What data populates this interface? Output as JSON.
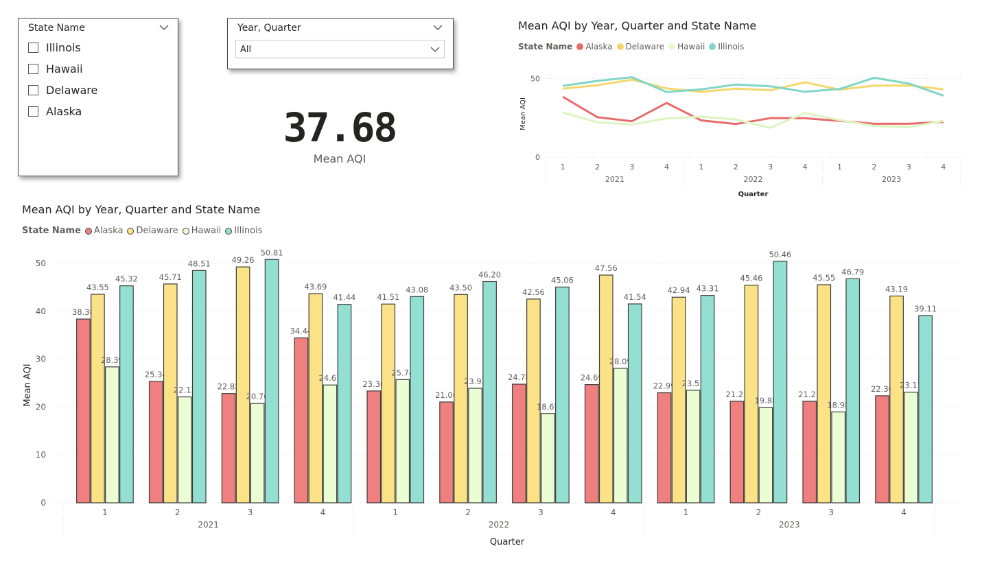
{
  "slicer_state": {
    "header": "State Name",
    "items": [
      "Illinois",
      "Hawaii",
      "Delaware",
      "Alaska"
    ]
  },
  "slicer_year": {
    "header": "Year, Quarter",
    "value": "All"
  },
  "kpi": {
    "value": "37.68",
    "label": "Mean AQI"
  },
  "legend": {
    "title": "State Name",
    "items": [
      {
        "name": "Alaska",
        "color": "#F08080",
        "stroke": "#E86C6C"
      },
      {
        "name": "Delaware",
        "color": "#FCE286",
        "stroke": "#F5D76E"
      },
      {
        "name": "Hawaii",
        "color": "#EBFED3",
        "stroke": "#DDF5C0"
      },
      {
        "name": "Illinois",
        "color": "#93E0D2",
        "stroke": "#7FD6C6"
      }
    ]
  },
  "line_chart": {
    "title": "Mean AQI by Year, Quarter and State Name",
    "ylabel": "Mean AQI",
    "xlabel": "Quarter"
  },
  "bar_chart": {
    "title": "Mean AQI by Year, Quarter and State Name",
    "ylabel": "Mean AQI",
    "xlabel": "Quarter"
  },
  "chart_data": [
    {
      "type": "line",
      "title": "Mean AQI by Year, Quarter and State Name",
      "xlabel": "Quarter",
      "ylabel": "Mean AQI",
      "categories": [
        "1",
        "2",
        "3",
        "4",
        "1",
        "2",
        "3",
        "4",
        "1",
        "2",
        "3",
        "4"
      ],
      "groups": [
        "2021",
        "2022",
        "2023"
      ],
      "yticks": [
        0,
        50
      ],
      "ylim": [
        0,
        55
      ],
      "grid": true,
      "legend_position": "top-left",
      "series": [
        {
          "name": "Alaska",
          "values": [
            38.38,
            25.34,
            22.82,
            34.44,
            23.36,
            21.06,
            24.78,
            24.69,
            22.99,
            21.21,
            21.21,
            22.36
          ]
        },
        {
          "name": "Delaware",
          "values": [
            43.55,
            45.71,
            49.26,
            43.69,
            41.51,
            43.5,
            42.56,
            47.56,
            42.94,
            45.46,
            45.55,
            43.19
          ]
        },
        {
          "name": "Hawaii",
          "values": [
            28.39,
            22.12,
            20.76,
            24.61,
            25.74,
            23.92,
            18.65,
            28.09,
            23.51,
            19.88,
            18.98,
            23.11
          ]
        },
        {
          "name": "Illinois",
          "values": [
            45.32,
            48.51,
            50.81,
            41.44,
            43.08,
            46.2,
            45.06,
            41.54,
            43.31,
            50.46,
            46.79,
            39.11
          ]
        }
      ]
    },
    {
      "type": "bar",
      "title": "Mean AQI by Year, Quarter and State Name",
      "xlabel": "Quarter",
      "ylabel": "Mean AQI",
      "categories": [
        "1",
        "2",
        "3",
        "4",
        "1",
        "2",
        "3",
        "4",
        "1",
        "2",
        "3",
        "4"
      ],
      "groups": [
        "2021",
        "2022",
        "2023"
      ],
      "yticks": [
        0,
        10,
        20,
        30,
        40,
        50
      ],
      "ylim": [
        0,
        52
      ],
      "grid": true,
      "legend_position": "top-left",
      "series": [
        {
          "name": "Alaska",
          "values": [
            38.38,
            25.34,
            22.82,
            34.44,
            23.36,
            21.06,
            24.78,
            24.69,
            22.99,
            21.21,
            21.21,
            22.36
          ],
          "labels": [
            "38.38",
            "25.34",
            "22.82",
            "34.44",
            "23.36",
            "21.06",
            "24.78",
            "24.69",
            "22.99",
            "21.21",
            "21.21",
            "22.36"
          ]
        },
        {
          "name": "Delaware",
          "values": [
            43.55,
            45.71,
            49.26,
            43.69,
            41.51,
            43.5,
            42.56,
            47.56,
            42.94,
            45.46,
            45.55,
            43.19
          ],
          "labels": [
            "43.55",
            "45.71",
            "49.26",
            "43.69",
            "41.51",
            "43.50",
            "42.56",
            "47.56",
            "42.94",
            "45.46",
            "45.55",
            "43.19"
          ]
        },
        {
          "name": "Hawaii",
          "values": [
            28.39,
            22.12,
            20.76,
            24.61,
            25.74,
            23.92,
            18.65,
            28.09,
            23.51,
            19.88,
            18.98,
            23.11
          ],
          "labels": [
            "28.39",
            "22.12",
            "20.76",
            "24.61",
            "25.74",
            "23.92",
            "18.65",
            "28.09",
            "23.51",
            "19.88",
            "18.98",
            "23.11"
          ]
        },
        {
          "name": "Illinois",
          "values": [
            45.32,
            48.51,
            50.81,
            41.44,
            43.08,
            46.2,
            45.06,
            41.54,
            43.31,
            50.46,
            46.79,
            39.11
          ],
          "labels": [
            "45.32",
            "48.51",
            "50.81",
            "41.44",
            "43.08",
            "46.20",
            "45.06",
            "41.54",
            "43.31",
            "50.46",
            "46.79",
            "39.11"
          ]
        }
      ]
    }
  ]
}
